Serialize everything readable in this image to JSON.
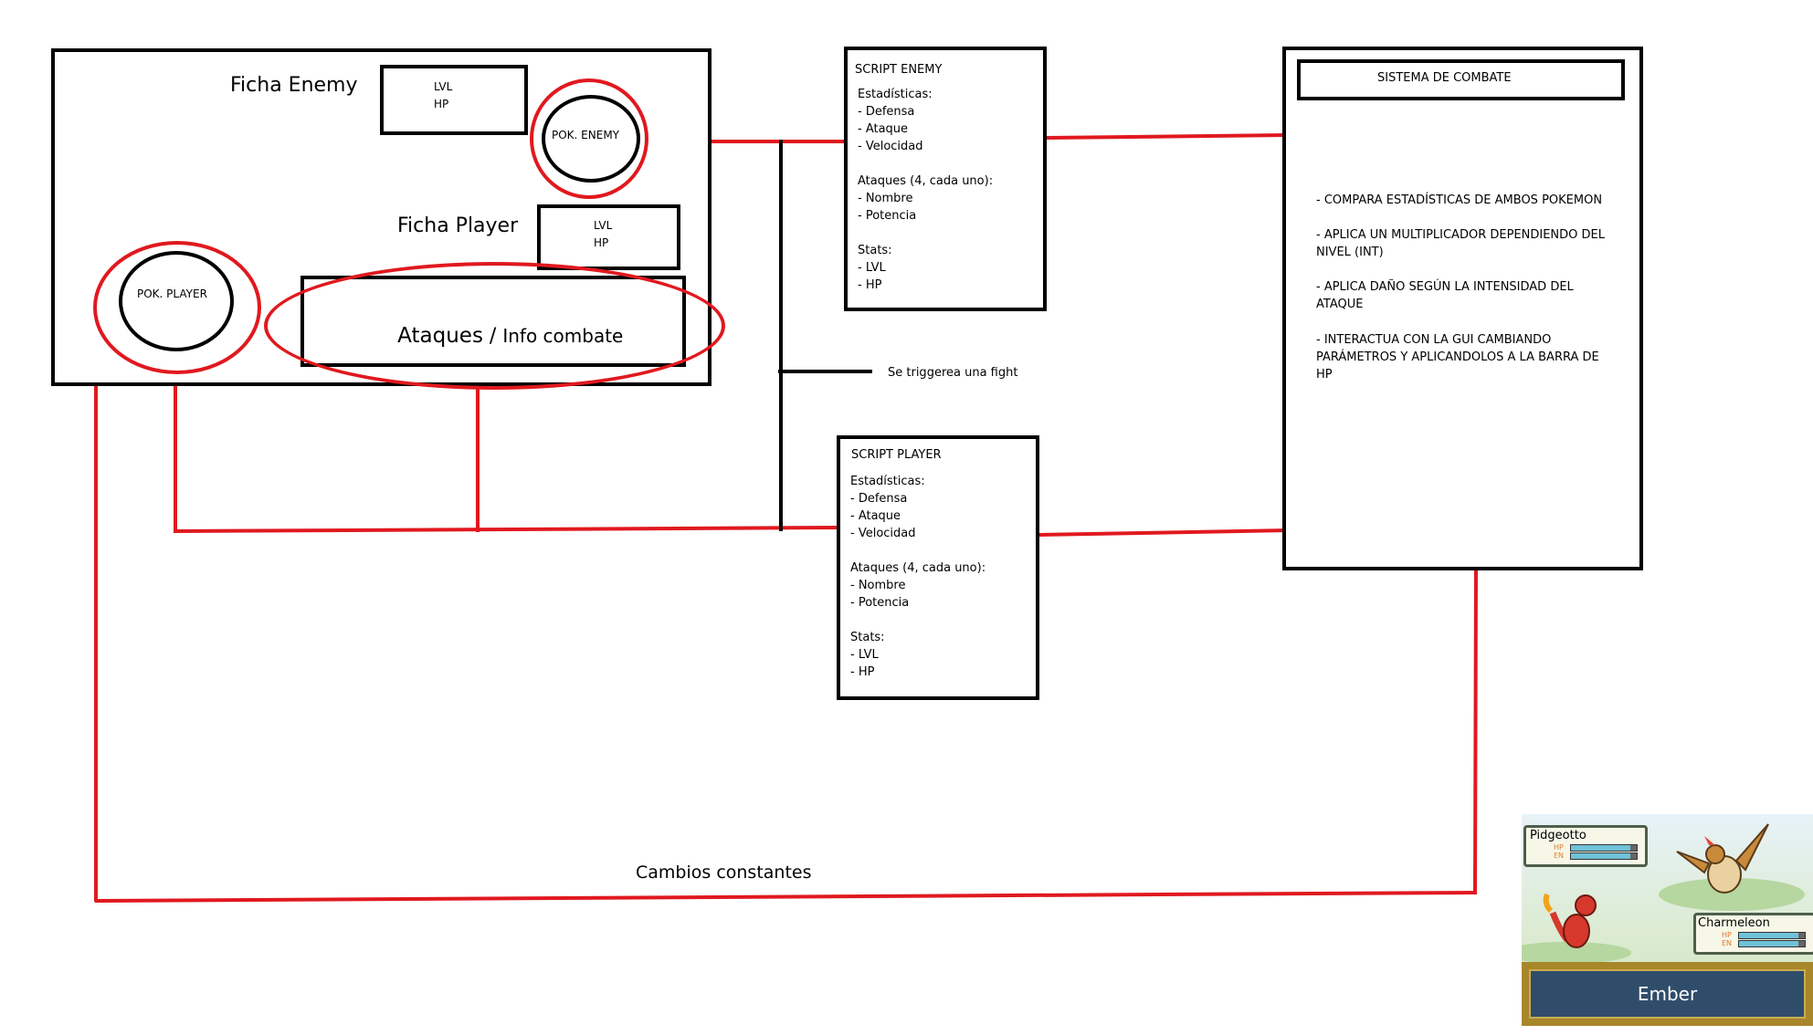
{
  "ficha_enemy": {
    "title": "Ficha Enemy",
    "stats": "LVL\nHP",
    "pokemon": "POK. ENEMY"
  },
  "ficha_player": {
    "title": "Ficha Player",
    "stats": "LVL\nHP",
    "pokemon": "POK. PLAYER"
  },
  "ataques": {
    "main": "Ataques",
    "sep": " / ",
    "rest": "Info combate"
  },
  "script_enemy": {
    "title": "SCRIPT ENEMY",
    "body": "Estadísticas:\n- Defensa\n- Ataque\n- Velocidad\n\nAtaques (4, cada uno):\n- Nombre\n- Potencia\n\nStats:\n- LVL\n- HP"
  },
  "script_player": {
    "title": "SCRIPT PLAYER",
    "body": "Estadísticas:\n- Defensa\n- Ataque\n- Velocidad\n\nAtaques (4, cada uno):\n- Nombre\n- Potencia\n\nStats:\n- LVL\n- HP"
  },
  "sistema": {
    "title": "SISTEMA DE COMBATE",
    "items": [
      "- COMPARA ESTADÍSTICAS DE AMBOS POKEMON",
      "- APLICA UN MULTIPLICADOR DEPENDIENDO DEL\nNIVEL (INT)",
      "- APLICA DAÑO SEGÚN LA INTENSIDAD DEL\nATAQUE",
      "- INTERACTUA CON LA GUI CAMBIANDO\nPARÁMETROS Y APLICANDOLOS A LA BARRA DE\nHP"
    ]
  },
  "trigger_label": "Se triggerea una fight",
  "cambios_label": "Cambios constantes",
  "game": {
    "enemy_name": "Pidgeotto",
    "player_name": "Charmeleon",
    "hp_label": "HP",
    "en_label": "EN",
    "enemy_hp": 0.9,
    "enemy_en": 0.9,
    "player_hp": 0.9,
    "player_en": 0.9,
    "move": "Ember"
  },
  "colors": {
    "accent_red": "#e0191f",
    "line_black": "#000000"
  }
}
